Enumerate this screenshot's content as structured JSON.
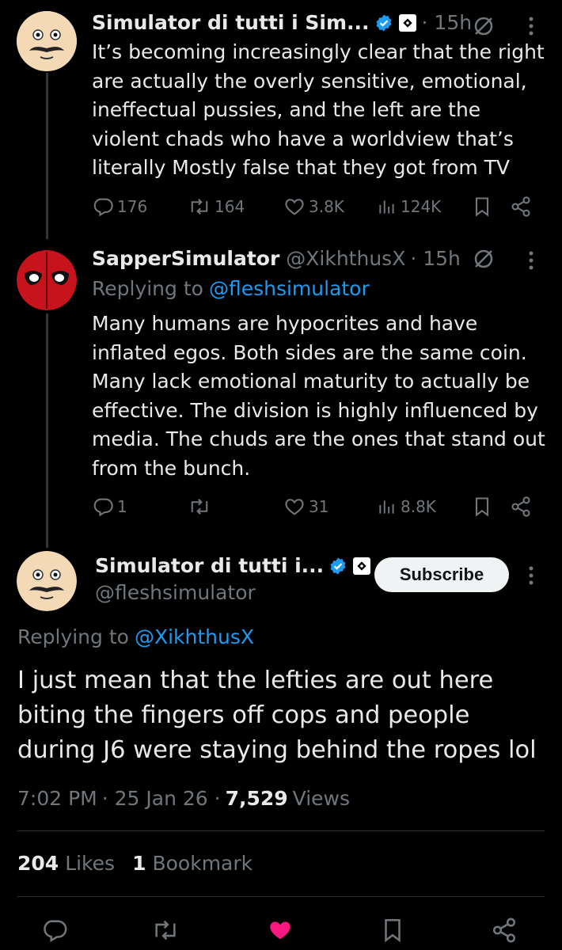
{
  "tweet1": {
    "display_name": "Simulator di tutti i Sim...",
    "time": "· 15h",
    "text": "It’s becoming increasingly clear that the right are actually the overly sensitive, emotional, ineffectual pussies, and the left are the violent chads who have a worldview that’s literally Mostly false that they got from TV",
    "replies": "176",
    "reposts": "164",
    "likes": "3.8K",
    "views": "124K"
  },
  "tweet2": {
    "display_name": "SapperSimulator",
    "handle": "@XikhthusX",
    "time": "· 15h",
    "replying_prefix": "Replying to",
    "replying_handle": "@fleshsimulator",
    "text": "Many humans are hypocrites and have inflated egos. Both sides are the same coin. Many lack emotional maturity to actually be effective. The division is highly influenced by media. The chuds are the ones that stand out from the bunch.",
    "replies": "1",
    "reposts": "",
    "likes": "31",
    "views": "8.8K"
  },
  "main_tweet": {
    "display_name": "Simulator di tutti i...",
    "handle": "@fleshsimulator",
    "subscribe_label": "Subscribe",
    "replying_prefix": "Replying to",
    "replying_handle": "@XikhthusX",
    "text": "I just mean that the lefties are out here biting the fingers off cops and people during J6 were staying behind the ropes lol",
    "time": "7:02 PM",
    "date": "· 25 Jan 26 ·",
    "views_count": "7,529",
    "views_label": "Views",
    "likes_count": "204",
    "likes_label": "Likes",
    "bookmarks_count": "1",
    "bookmarks_label": "Bookmark"
  },
  "colors": {
    "background": "#000000",
    "text": "#e7e9ea",
    "muted": "#71767b",
    "link": "#1d9bf0",
    "like_active": "#f91880",
    "verified": "#1d9bf0"
  },
  "icons": [
    "reply-icon",
    "repost-icon",
    "like-icon",
    "views-icon",
    "bookmark-icon",
    "share-icon",
    "grok-icon",
    "more-icon",
    "verified-icon",
    "affiliate-badge-icon"
  ]
}
